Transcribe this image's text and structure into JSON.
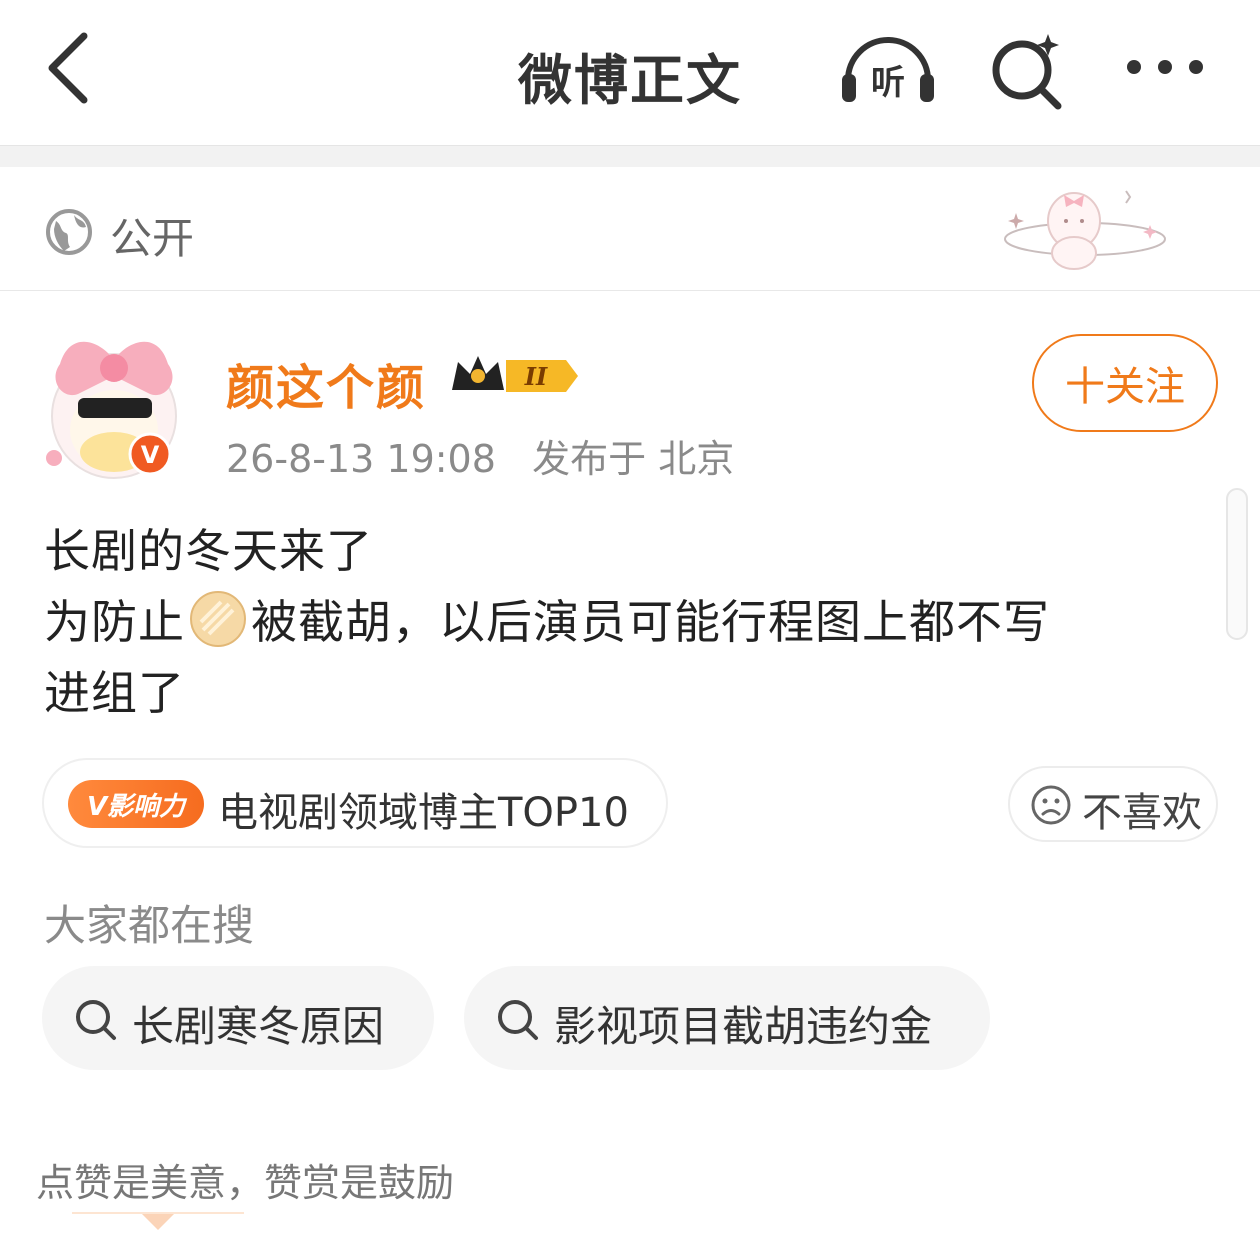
{
  "header": {
    "title": "微博正文",
    "icons": [
      "back-icon",
      "listen-icon",
      "search-icon",
      "more-icon"
    ],
    "listen_icon_text": "听"
  },
  "visibility": {
    "label": "公开",
    "icon": "globe-icon"
  },
  "author": {
    "name": "颜这个颜",
    "vip_level": "II",
    "verified": true,
    "verified_mark": "V",
    "post_time": "26-8-13 19:08",
    "location": "发布于 北京",
    "follow_label": "十关注",
    "accent_color": "#f07a1a"
  },
  "post": {
    "line1": "长剧的冬天来了",
    "line2_a": "为防止",
    "line2_b": "被截胡，以后演员可能行程图上都不写",
    "line3": "进组了"
  },
  "influence": {
    "badge": "V影响力",
    "text": "电视剧领域博主TOP10"
  },
  "dislike": {
    "label": "不喜欢",
    "icon": "sad-face-icon"
  },
  "search_section": {
    "title": "大家都在搜",
    "chips": [
      {
        "label": "长剧寒冬原因"
      },
      {
        "label": "影视项目截胡违约金"
      }
    ]
  },
  "reward": {
    "note": "点赞是美意，赞赏是鼓励"
  }
}
